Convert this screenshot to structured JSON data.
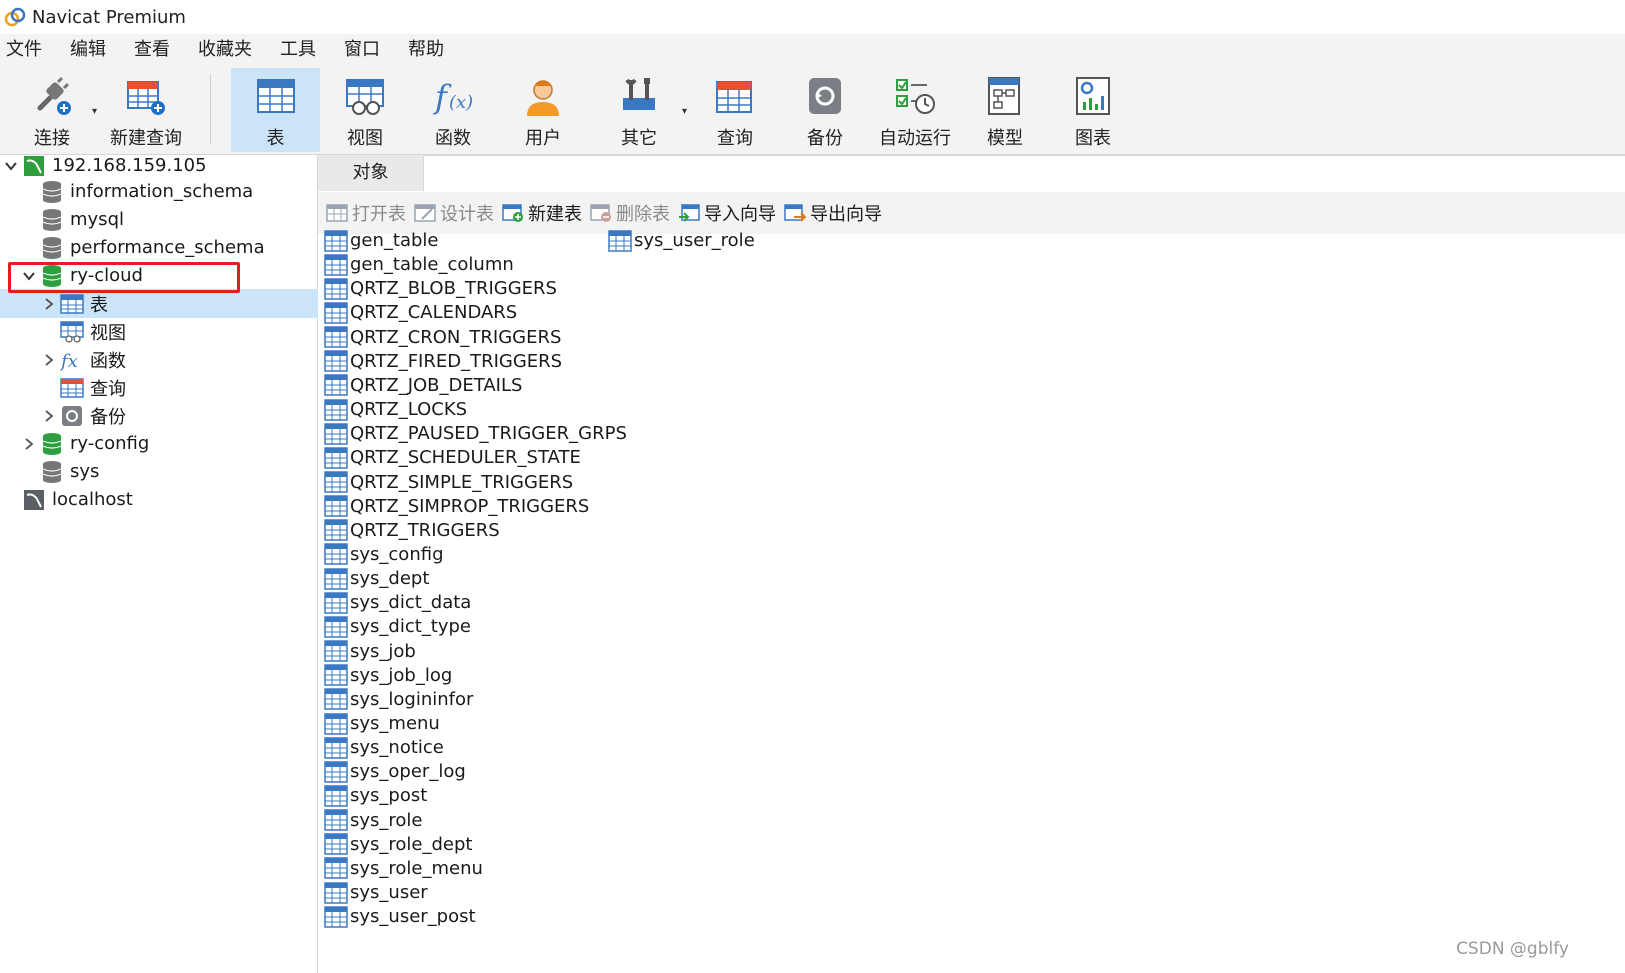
{
  "window": {
    "title": "Navicat Premium"
  },
  "menu": [
    "文件",
    "编辑",
    "查看",
    "收藏夹",
    "工具",
    "窗口",
    "帮助"
  ],
  "toolbar": {
    "connect": "连接",
    "new_query": "新建查询",
    "table": "表",
    "view": "视图",
    "function": "函数",
    "user": "用户",
    "other": "其它",
    "query": "查询",
    "backup": "备份",
    "auto_run": "自动运行",
    "model": "模型",
    "chart": "图表"
  },
  "tree": {
    "connection": "192.168.159.105",
    "databases": {
      "information_schema": "information_schema",
      "mysql": "mysql",
      "performance_schema": "performance_schema",
      "ry_cloud": "ry-cloud",
      "ry_config": "ry-config",
      "sys": "sys"
    },
    "children": {
      "tables": "表",
      "views": "视图",
      "functions": "函数",
      "queries": "查询",
      "backups": "备份"
    },
    "localhost": "localhost"
  },
  "content": {
    "tab": "对象",
    "actions": {
      "open": "打开表",
      "design": "设计表",
      "new": "新建表",
      "delete": "删除表",
      "import": "导入向导",
      "export": "导出向导"
    },
    "tables_col1": [
      "gen_table",
      "gen_table_column",
      "QRTZ_BLOB_TRIGGERS",
      "QRTZ_CALENDARS",
      "QRTZ_CRON_TRIGGERS",
      "QRTZ_FIRED_TRIGGERS",
      "QRTZ_JOB_DETAILS",
      "QRTZ_LOCKS",
      "QRTZ_PAUSED_TRIGGER_GRPS",
      "QRTZ_SCHEDULER_STATE",
      "QRTZ_SIMPLE_TRIGGERS",
      "QRTZ_SIMPROP_TRIGGERS",
      "QRTZ_TRIGGERS",
      "sys_config",
      "sys_dept",
      "sys_dict_data",
      "sys_dict_type",
      "sys_job",
      "sys_job_log",
      "sys_logininfor",
      "sys_menu",
      "sys_notice",
      "sys_oper_log",
      "sys_post",
      "sys_role",
      "sys_role_dept",
      "sys_role_menu",
      "sys_user",
      "sys_user_post"
    ],
    "tables_col2": [
      "sys_user_role"
    ]
  },
  "watermark": "CSDN @gblfy",
  "colors": {
    "selection": "#cce4f7",
    "highlight_box": "#e41e1e",
    "db_active": "#2e9e3e",
    "table_icon": "#3b78c4"
  }
}
